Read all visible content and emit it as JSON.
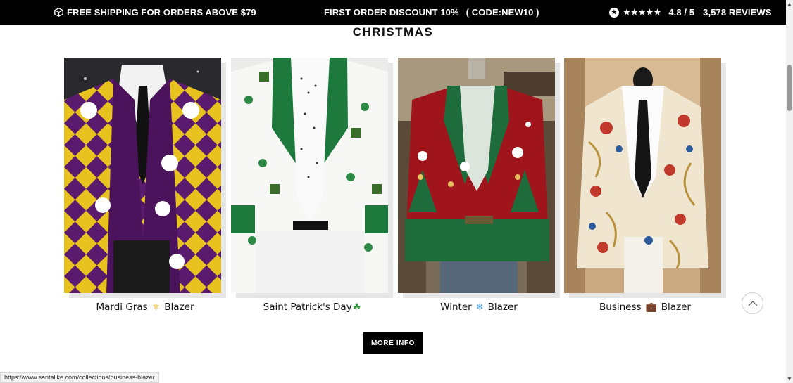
{
  "announcement": {
    "shipping": "FREE SHIPPING FOR ORDERS ABOVE $79",
    "discount": "FIRST ORDER DISCOUNT 10%",
    "code": "( CODE:NEW10 )",
    "stars": "★★★★★",
    "rating": "4.8 / 5",
    "reviews": "3,578 REVIEWS"
  },
  "section": {
    "title": "CHRISTMAS"
  },
  "cards": [
    {
      "label_a": "Mardi Gras",
      "emoji": "⚜",
      "label_b": "Blazer"
    },
    {
      "label_a": "Saint Patrick's Day",
      "emoji": "☘",
      "label_b": ""
    },
    {
      "label_a": "Winter",
      "emoji": "❄",
      "label_b": "Blazer"
    },
    {
      "label_a": "Business",
      "emoji": "💼",
      "label_b": "Blazer"
    }
  ],
  "more_button": "MORE INFO",
  "status_url": "https://www.santalike.com/collections/business-blazer",
  "colors": {
    "topbar": "#000000",
    "button": "#000000",
    "accent_green": "#1f7a3a"
  },
  "icons": [
    "box-icon",
    "rating-badge-icon",
    "star-icon",
    "chevron-up-icon"
  ]
}
